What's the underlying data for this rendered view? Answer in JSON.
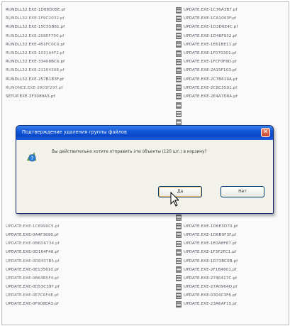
{
  "left_files": [
    "RUNDLL32.EXE-1D88D05E.pf",
    "RUNDLL32.EXE-1F9C2032.pf",
    "RUNDLL32.EXE-15C55B81.pf",
    "RUNDLL32.EXE-208EF790.pf",
    "RUNDLL32.EXE-451FC0C0.pf",
    "RUNDLL32.EXE-1031A4F2.pf",
    "RUNDLL32.EXE-33408BC6.pf",
    "RUNDLL32.EXE-21164308.pf",
    "RUNDLL32.EXE-257B1B3F.pf",
    "RUNONCE.EXE-2803F297.pf",
    "SETUP.EXE-3F3089A5.pf",
    "",
    "",
    "",
    "",
    "",
    "",
    "",
    "",
    "",
    "",
    "",
    "",
    "",
    "",
    "UPDATE.EXE-1C8996C5.pf",
    "UPDATE.EXE-0A4F3690.pf",
    "UPDATE.EXE-0B6D6734.pf",
    "UPDATE.EXE-0D164F46.pf",
    "UPDATE.EXE-0D8407B5.pf",
    "UPDATE.EXE-0E135610.pf",
    "UPDATE.EXE-0B64B5F4.pf",
    "UPDATE.EXE-0D53C397.pf",
    "UPDATE.EXE-0E7C6F4E.pf",
    "UPDATE.EXE-0F908EA3.pf"
  ],
  "right_files": [
    "UPDATE.EXE-1C76A3B7.pf",
    "UPDATE.EXE-1CA1003F.pf",
    "UPDATE.EXE-1D3D6E4C.pf",
    "UPDATE.EXE-1D48F932.pf",
    "UPDATE.EXE-1E61BE11.pf",
    "UPDATE.EXE-1F070301.pf",
    "UPDATE.EXE-1FCF0F8D.pf",
    "UPDATE.EXE-2A15F103.pf",
    "UPDATE.EXE-2C7B619A.pf",
    "UPDATE.EXE-2C8C3501.pf",
    "UPDATE.EXE-2E4A7D6A.pf",
    "",
    "",
    "",
    "",
    "",
    "",
    "",
    "",
    "",
    "",
    "",
    "",
    "",
    "",
    "UPDATE.EXE-1D6E3D70.pf",
    "UPDATE.EXE-1D6B9F3F.pf",
    "UPDATE.EXE-1E0A8F87.pf",
    "UPDATE.EXE-1F3F2FC1.pf",
    "UPDATE.EXE-1D73BC0B.pf",
    "UPDATE.EXE-2F1B4801.pf",
    "UPDATE.EXE-2746417C.pf",
    "UPDATE.EXE-27A0964D.pf",
    "UPDATE.EXE-0304C3F6.pf",
    "UPDATE.EXE-23A6AF15.pf"
  ],
  "dialog": {
    "title": "Подтверждение удаления группы файлов",
    "message": "Вы действительно хотите отправить эти объекты (120 шт.) в корзину?",
    "yes_label": "Да",
    "no_label": "Нет",
    "close_glyph": "✕"
  },
  "colors": {
    "titlebar": "#0a48c8",
    "dialog_bg": "#ece9d8",
    "close": "#c9452a"
  },
  "icons": {
    "question": "question-icon",
    "file": "prefetch-file-icon",
    "cursor": "mouse-pointer-icon"
  }
}
